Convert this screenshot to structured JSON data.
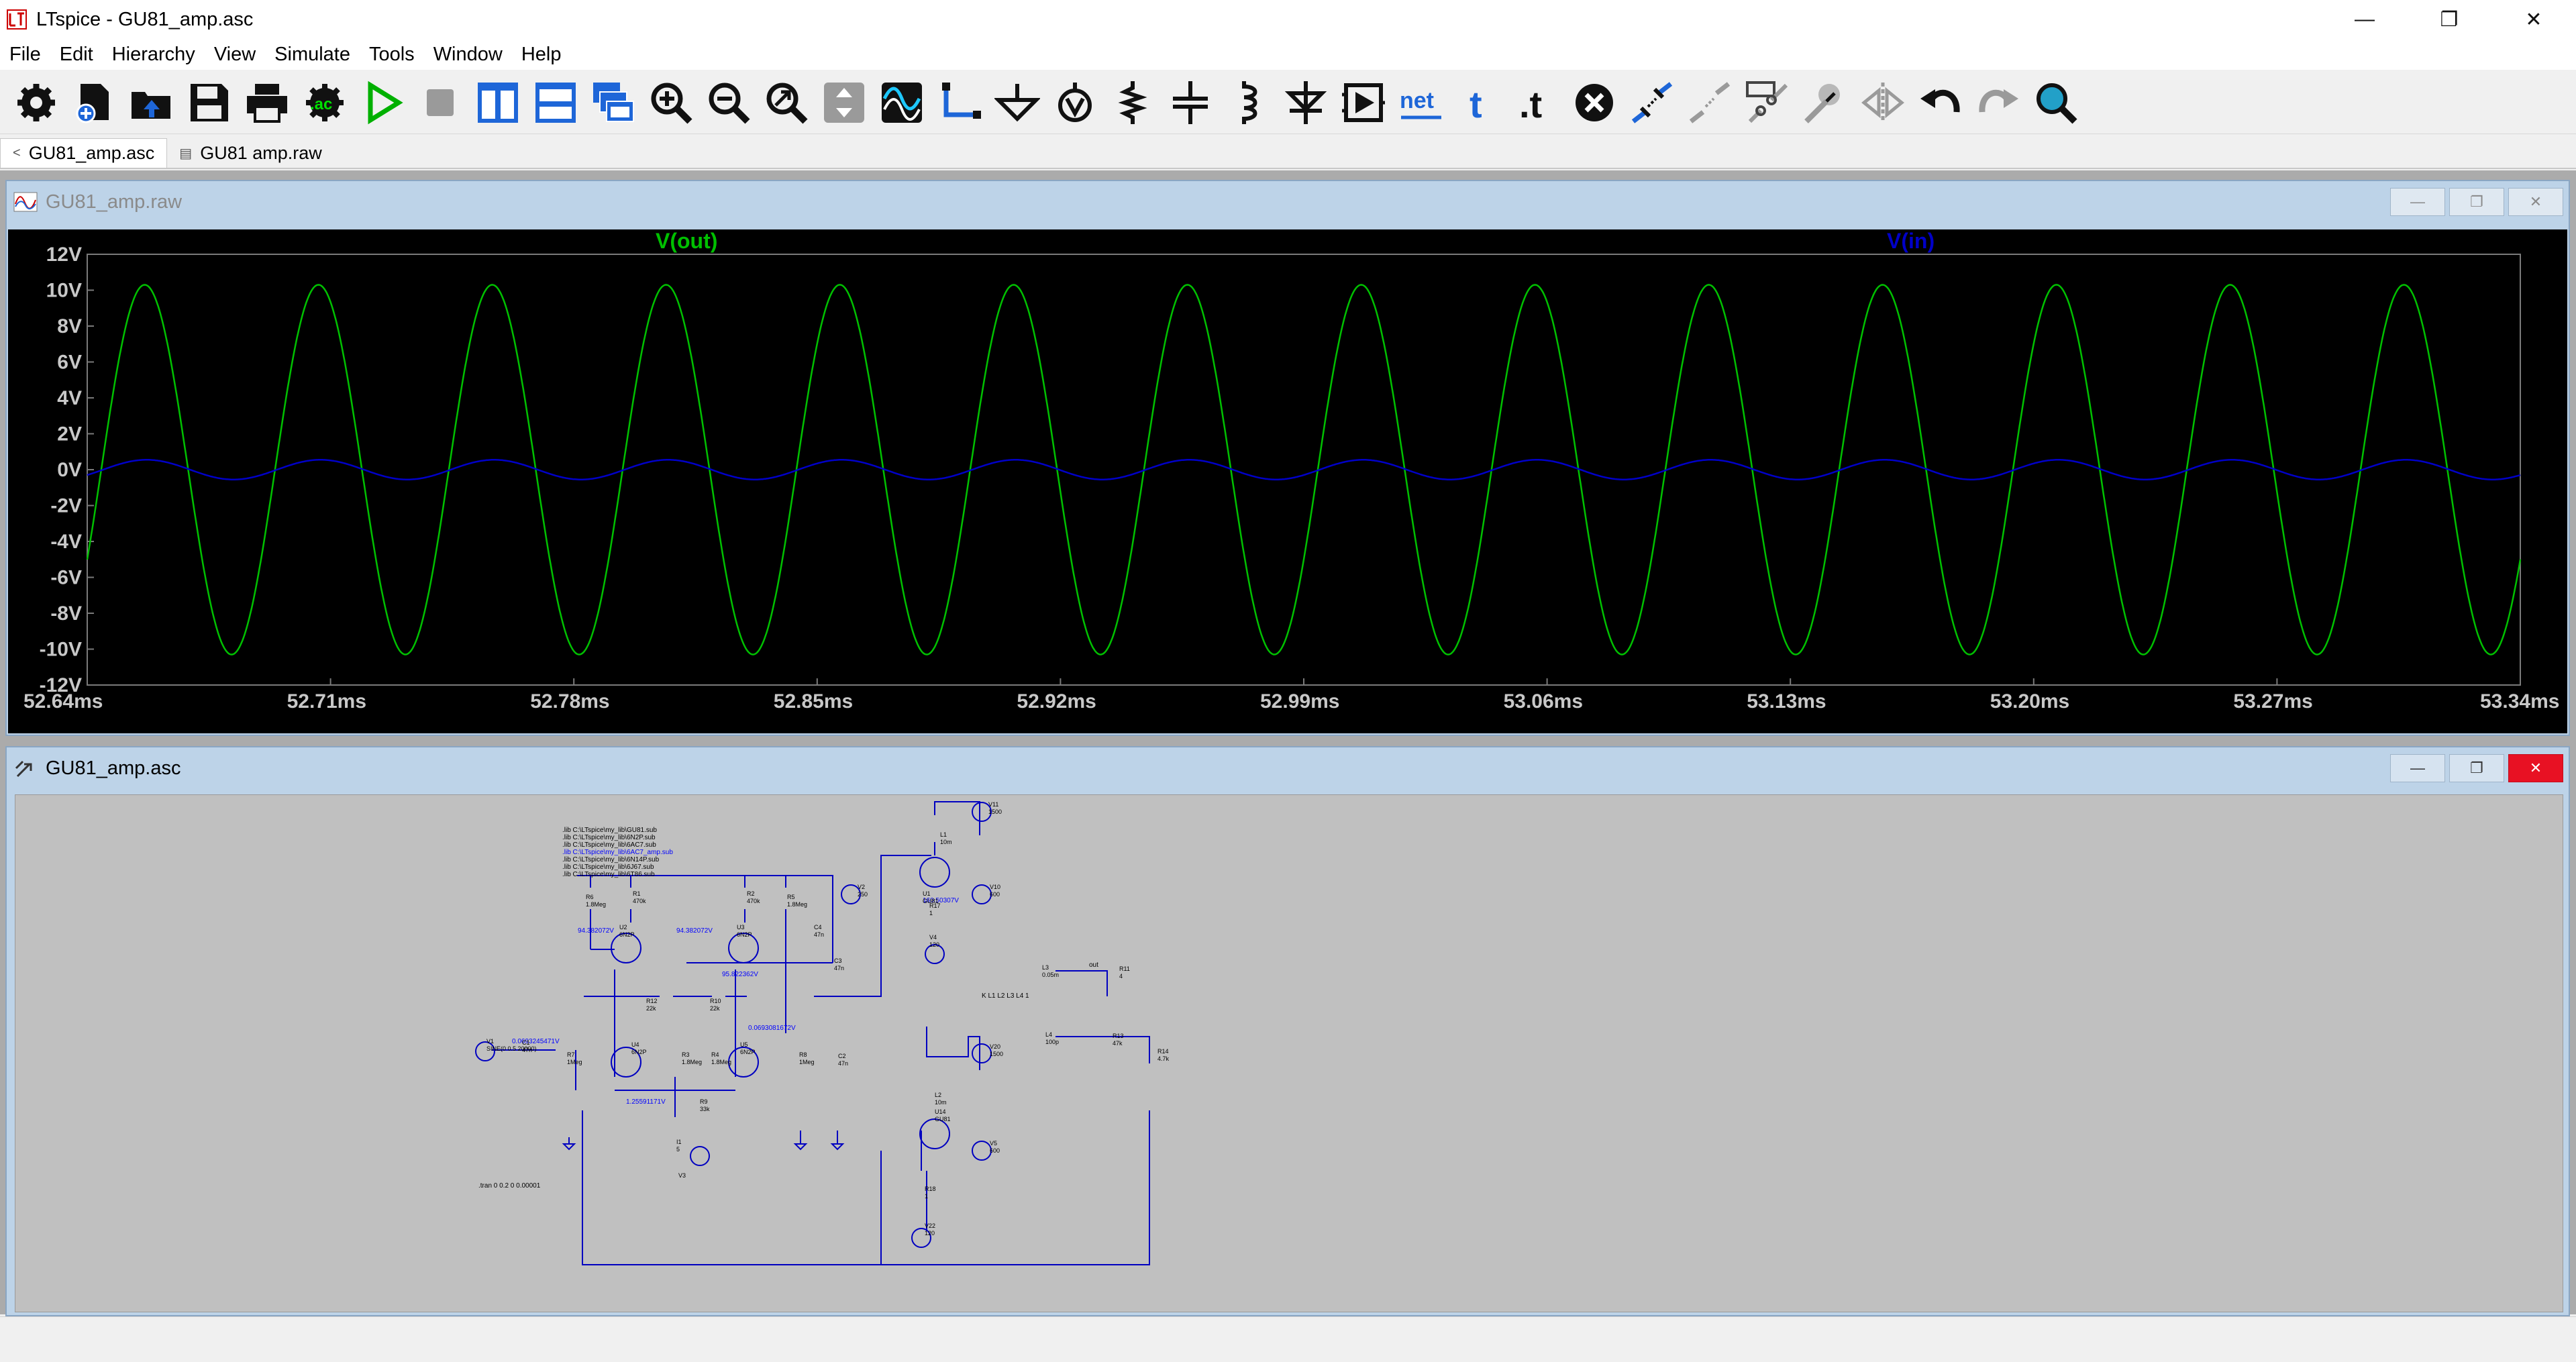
{
  "window": {
    "title": "LTspice - GU81_amp.asc",
    "minimize_glyph": "—",
    "restore_glyph": "❐",
    "close_glyph": "✕"
  },
  "menu": [
    "File",
    "Edit",
    "Hierarchy",
    "View",
    "Simulate",
    "Tools",
    "Window",
    "Help"
  ],
  "toolbar": {
    "icons": [
      "gear-icon",
      "new-schematic-icon",
      "open-folder-icon",
      "save-icon",
      "print-icon",
      "ac-analysis-icon",
      "run-icon",
      "halt-icon",
      "tile-vertical-icon",
      "tile-horizontal-icon",
      "cascade-icon",
      "zoom-in-icon",
      "zoom-out-icon",
      "zoom-fit-icon",
      "autorange-icon",
      "waveform-icon",
      "wire-icon",
      "ground-icon",
      "label-net-icon",
      "resistor-icon",
      "capacitor-icon",
      "inductor-icon",
      "diode-icon",
      "component-icon",
      "net-label-icon",
      "text-icon",
      "spice-directive-icon",
      "delete-icon",
      "move-icon",
      "drag-icon",
      "copy-icon",
      "paste-icon",
      "mirror-icon",
      "undo-icon",
      "redo-icon",
      "find-icon"
    ],
    "ac_label": ".ac",
    "net_label": "net",
    "text_label": "t",
    "directive_label": ".t"
  },
  "tabs": [
    {
      "label": "GU81_amp.asc",
      "icon": "schematic-tab-icon",
      "active": true
    },
    {
      "label": "GU81  amp.raw",
      "icon": "waveform-tab-icon",
      "active": false
    }
  ],
  "plot_window": {
    "title": "GU81_amp.raw",
    "traces": [
      {
        "name": "V(out)",
        "color": "#00c000"
      },
      {
        "name": "V(in)",
        "color": "#0000c8"
      }
    ],
    "y_ticks": [
      "12V",
      "10V",
      "8V",
      "6V",
      "4V",
      "2V",
      "0V",
      "-2V",
      "-4V",
      "-6V",
      "-8V",
      "-10V",
      "-12V"
    ],
    "x_ticks": [
      "52.64ms",
      "52.71ms",
      "52.78ms",
      "52.85ms",
      "52.92ms",
      "52.99ms",
      "53.06ms",
      "53.13ms",
      "53.20ms",
      "53.27ms",
      "53.34ms"
    ]
  },
  "chart_data": {
    "type": "line",
    "title": "",
    "xlabel": "",
    "ylabel": "",
    "x_range_ms": [
      52.64,
      53.34
    ],
    "ylim": [
      -12,
      12
    ],
    "grid": false,
    "series": [
      {
        "name": "V(out)",
        "waveform": "sine",
        "amplitude_v": 10.3,
        "offset_v": 0,
        "cycles_in_view": 14,
        "value_at_start_v": -5.0,
        "value_at_end_v": -5.0
      },
      {
        "name": "V(in)",
        "waveform": "sine",
        "amplitude_v": 0.55,
        "offset_v": 0,
        "cycles_in_view": 14,
        "value_at_start_v": -0.3,
        "value_at_end_v": -0.3
      }
    ]
  },
  "schematic_window": {
    "title": "GU81_amp.asc",
    "lib_lines": [
      ".lib C:\\LTspice\\my_lib\\GU81.sub",
      ".lib C:\\LTspice\\my_lib\\6N2P.sub",
      ".lib C:\\LTspice\\my_lib\\6AC7.sub",
      ".lib C:\\LTspice\\my_lib\\6AC7_amp.sub",
      ".lib C:\\LTspice\\my_lib\\6N14P.sub",
      ".lib C:\\LTspice\\my_lib\\6J67.sub",
      ".lib C:\\LTspice\\my_lib\\6T86.sub"
    ],
    "tran_directive": ".tran 0 0.2 0 0.00001",
    "coupling_directive": "K L1 L2 L3 L4 1",
    "out_label": "out",
    "node_voltages": [
      "94.382072V",
      "94.382072V",
      "95.822362V",
      "0.0693081672V",
      "1.25591171V",
      "0.0693245471V",
      "160.50307V"
    ],
    "components": [
      {
        "ref": "V11",
        "val": "1500"
      },
      {
        "ref": "L1",
        "val": "10m"
      },
      {
        "ref": "V10",
        "val": "600"
      },
      {
        "ref": "U1",
        "val": "GU81"
      },
      {
        "ref": "R17",
        "val": "1"
      },
      {
        "ref": "V4",
        "val": "120"
      },
      {
        "ref": "V2",
        "val": "250"
      },
      {
        "ref": "R6",
        "val": "1.8Meg"
      },
      {
        "ref": "R1",
        "val": "470k"
      },
      {
        "ref": "R2",
        "val": "470k"
      },
      {
        "ref": "R5",
        "val": "1.8Meg"
      },
      {
        "ref": "C4",
        "val": "47n"
      },
      {
        "ref": "C3",
        "val": "47n"
      },
      {
        "ref": "U2",
        "val": "6N2P"
      },
      {
        "ref": "U3",
        "val": "6N2P"
      },
      {
        "ref": "R12",
        "val": "22k"
      },
      {
        "ref": "R10",
        "val": "22k"
      },
      {
        "ref": "V1",
        "val": "SINE(0 0.5 20000)"
      },
      {
        "ref": "C1",
        "val": "47n"
      },
      {
        "ref": "R7",
        "val": "1Meg"
      },
      {
        "ref": "U4",
        "val": "6N2P"
      },
      {
        "ref": "R3",
        "val": "1.8Meg"
      },
      {
        "ref": "R4",
        "val": "1.8Meg"
      },
      {
        "ref": "U5",
        "val": "6N2P"
      },
      {
        "ref": "R8",
        "val": "1Meg"
      },
      {
        "ref": "C2",
        "val": "47n"
      },
      {
        "ref": "R9",
        "val": "33k"
      },
      {
        "ref": "I1",
        "val": "5"
      },
      {
        "ref": "V3",
        "val": ""
      },
      {
        "ref": "L3",
        "val": "0.05m"
      },
      {
        "ref": "R11",
        "val": "4"
      },
      {
        "ref": "L4",
        "val": "100p"
      },
      {
        "ref": "R13",
        "val": "47k"
      },
      {
        "ref": "R14",
        "val": "4.7k"
      },
      {
        "ref": "V20",
        "val": "1500"
      },
      {
        "ref": "L2",
        "val": "10m"
      },
      {
        "ref": "V5",
        "val": "600"
      },
      {
        "ref": "U14",
        "val": "GU81"
      },
      {
        "ref": "R18",
        "val": "1"
      },
      {
        "ref": "V22",
        "val": "120"
      }
    ]
  }
}
